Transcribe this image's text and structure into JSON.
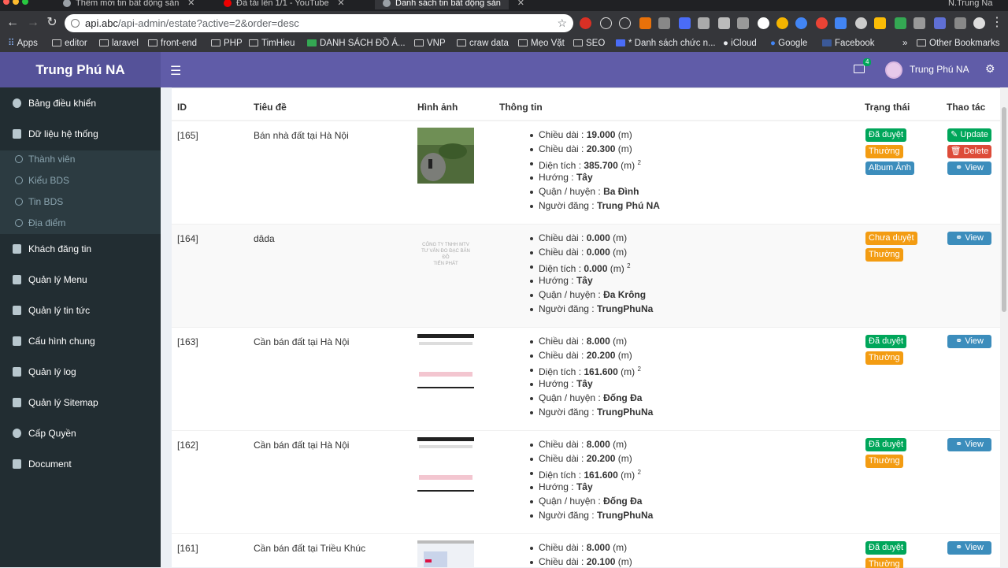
{
  "browser": {
    "tabs": [
      {
        "title": "Thêm mới tin bất động sản"
      },
      {
        "title": "Đã tải lên 1/1 - YouTube"
      },
      {
        "title": "Danh sách tin bất động sản"
      }
    ],
    "url_host": "api.abc",
    "url_path": "/api-admin/estate?active=2&order=desc",
    "profile": "N.Trung Na",
    "bookmarks": [
      "Apps",
      "editor",
      "laravel",
      "front-end",
      "PHP",
      "TimHieu",
      "DANH SÁCH ĐỒ Á...",
      "VNP",
      "craw data",
      "Mẹo Vặt",
      "SEO",
      "* Danh sách chức n...",
      "iCloud",
      "Google",
      "Facebook",
      "»",
      "Other Bookmarks"
    ]
  },
  "header": {
    "logo": "Trung Phú NA",
    "mail_count": "4",
    "user_name": "Trung Phú NA"
  },
  "sidebar": {
    "items": [
      {
        "label": "Bảng điều khiển"
      },
      {
        "label": "Dữ liệu hệ thống"
      },
      {
        "label": "Khách đăng tin"
      },
      {
        "label": "Quản lý Menu"
      },
      {
        "label": "Quản lý tin tức"
      },
      {
        "label": "Cấu hình chung"
      },
      {
        "label": "Quản lý log"
      },
      {
        "label": "Quản lý Sitemap"
      },
      {
        "label": "Cấp Quyền"
      },
      {
        "label": "Document"
      }
    ],
    "subitems": [
      {
        "label": "Thành viên"
      },
      {
        "label": "Kiểu BDS"
      },
      {
        "label": "Tin BDS"
      },
      {
        "label": "Địa điểm"
      }
    ]
  },
  "table": {
    "headers": {
      "id": "ID",
      "title": "Tiêu đề",
      "image": "Hình ảnh",
      "info": "Thông tin",
      "status": "Trạng thái",
      "actions": "Thao tác"
    },
    "info_labels": {
      "length": "Chiều dài :",
      "width": "Chiều dài :",
      "area": "Diện tích :",
      "direction": "Hướng :",
      "district": "Quận / huyện :",
      "poster": "Người đăng :",
      "unit": "(m)",
      "sup": "2"
    },
    "rows": [
      {
        "id": "[165]",
        "title": "Bán nhà đất tại Hà Nội",
        "length": "19.000",
        "width": "20.300",
        "area": "385.700",
        "direction": "Tây",
        "district": "Ba Đình",
        "poster": "Trung Phú NA",
        "status": "Đã duyệt",
        "type": "Thường",
        "album": "Album Ảnh",
        "update": "Update",
        "delete": "Delete",
        "view": "View",
        "image_text": ""
      },
      {
        "id": "[164]",
        "title": "dâda",
        "length": "0.000",
        "width": "0.000",
        "area": "0.000",
        "direction": "Tây",
        "district": "Đa Krông",
        "poster": "TrungPhuNa",
        "status": "Chưa duyệt",
        "type": "Thường",
        "view": "View",
        "image_text": "CÔNG TY TNHH MTV\nTƯ VẤN ĐO ĐẠC BẢN ĐỒ\nTIẾN PHÁT"
      },
      {
        "id": "[163]",
        "title": "Cần bán đất tại Hà Nội",
        "length": "8.000",
        "width": "20.200",
        "area": "161.600",
        "direction": "Tây",
        "district": "Đống Đa",
        "poster": "TrungPhuNa",
        "status": "Đã duyệt",
        "type": "Thường",
        "view": "View"
      },
      {
        "id": "[162]",
        "title": "Cần bán đất tại Hà Nội",
        "length": "8.000",
        "width": "20.200",
        "area": "161.600",
        "direction": "Tây",
        "district": "Đống Đa",
        "poster": "TrungPhuNa",
        "status": "Đã duyệt",
        "type": "Thường",
        "view": "View"
      },
      {
        "id": "[161]",
        "title": "Cần bán đất tại Triều Khúc",
        "length": "8.000",
        "width": "20.100",
        "status": "Đã duyệt",
        "type": "Thường",
        "view": "View"
      }
    ]
  }
}
